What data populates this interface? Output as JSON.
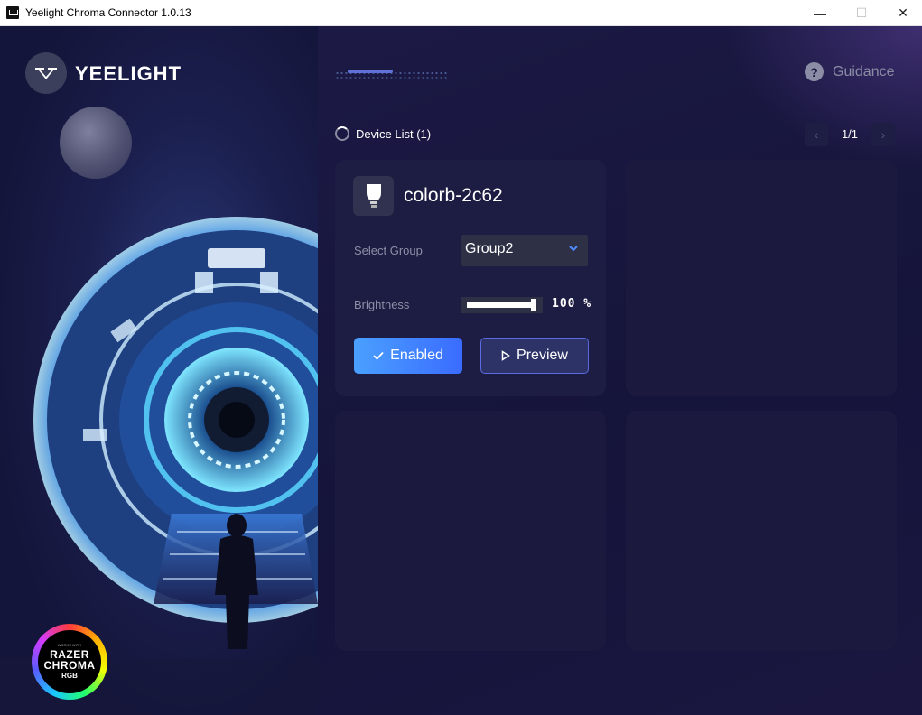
{
  "window": {
    "title": "Yeelight Chroma Connector 1.0.13",
    "min_label": "—",
    "max_label": "☐",
    "close_label": "✕"
  },
  "brand": {
    "name": "YEELIGHT",
    "icon": "yeelight-logo-icon"
  },
  "header": {
    "guidance_icon": "question-icon",
    "guidance_label": "Guidance"
  },
  "device_list": {
    "label": "Device List (1)",
    "page_label": "1/1",
    "prev_icon": "chevron-left-icon",
    "next_icon": "chevron-right-icon"
  },
  "device": {
    "icon": "bulb-icon",
    "name": "colorb-2c62",
    "group_label": "Select Group",
    "group_value": "Group2",
    "brightness_label": "Brightness",
    "brightness_value": 100,
    "brightness_text": "100 %",
    "enabled_label": "Enabled",
    "preview_label": "Preview"
  },
  "badge": {
    "small_text": "WORKS WITH",
    "line1": "RAZER",
    "line2": "CHROMA",
    "line3": "RGB"
  },
  "colors": {
    "accent": "#3a6cff",
    "background": "#161530",
    "card": "#1d1c42"
  }
}
